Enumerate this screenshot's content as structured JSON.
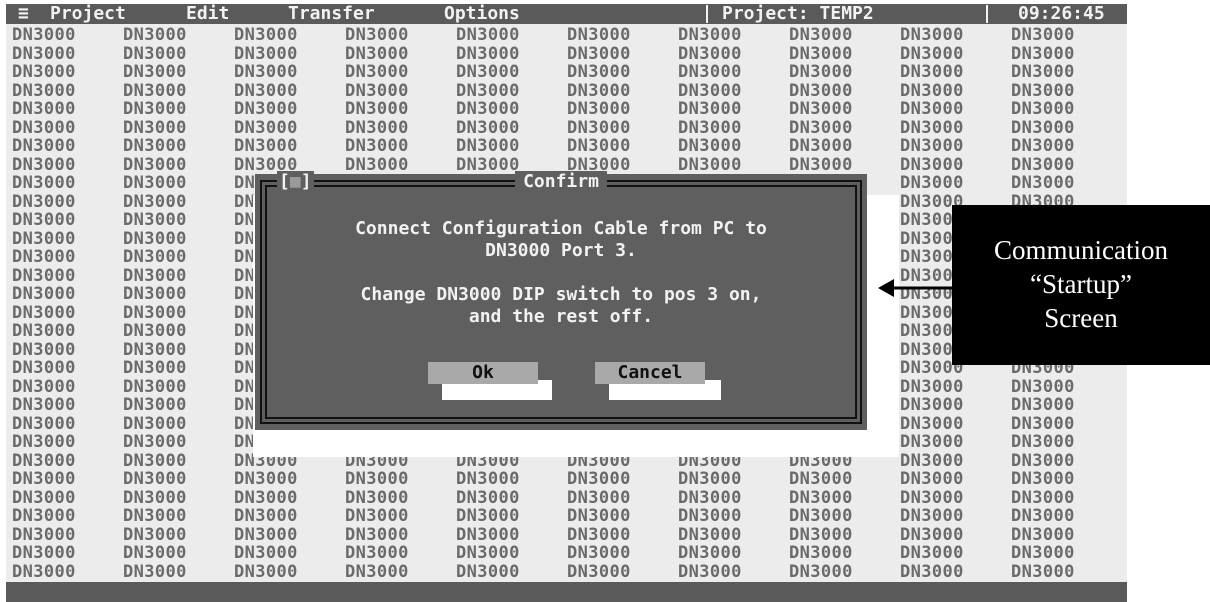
{
  "menubar": {
    "system_menu": "≡",
    "items": [
      "Project",
      "Edit",
      "Transfer",
      "Options"
    ],
    "project_label": "Project: TEMP2",
    "clock": "09:26:45"
  },
  "grid": {
    "cell_text": "DN3000",
    "columns": 10,
    "rows": 30
  },
  "dialog": {
    "close_glyph": "[■]",
    "title": "Confirm",
    "message_lines": [
      "Connect Configuration Cable from PC to",
      "DN3000 Port 3.",
      "",
      "Change DN3000 DIP switch to pos 3 on,",
      "and the rest off."
    ],
    "ok_label": "Ok",
    "cancel_label": "Cancel"
  },
  "callout": {
    "lines": [
      "Communication",
      "“Startup”",
      "Screen"
    ]
  },
  "colors": {
    "menubar_bg": "#5a5a5a",
    "dialog_bg": "#5f5f5f",
    "button_bg": "#a9a9a9",
    "screen_bg": "#ececec",
    "grid_text": "#6a6a6a"
  }
}
